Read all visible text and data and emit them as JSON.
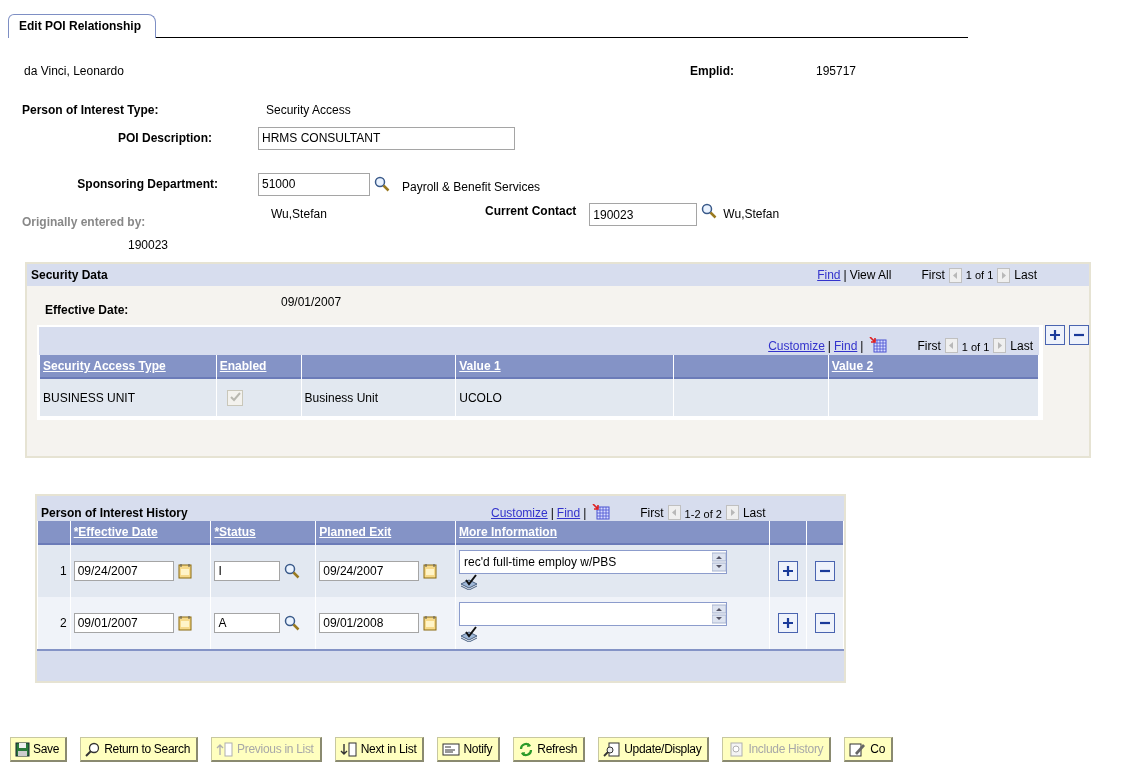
{
  "tab": {
    "label": "Edit POI Relationship",
    "selected": true
  },
  "person": {
    "name": "da Vinci, Leonardo",
    "emplid_label": "Emplid:",
    "emplid": "195717"
  },
  "poi_type": {
    "label": "Person of Interest Type:",
    "value": "Security Access"
  },
  "poi_description": {
    "label": "POI Description:",
    "value": "HRMS CONSULTANT"
  },
  "sponsoring_department": {
    "label": "Sponsoring Department:",
    "value": "51000",
    "description": "Payroll & Benefit Services"
  },
  "originally_entered_by": {
    "label": "Originally entered by:",
    "name": "Wu,Stefan",
    "number": "190023"
  },
  "current_contact": {
    "label": "Current Contact",
    "value": "190023",
    "name": "Wu,Stefan"
  },
  "security_data": {
    "title": "Security Data",
    "find": "Find",
    "separator": "|",
    "view_all": "View All",
    "nav": {
      "first": "First",
      "count": "1 of 1",
      "last": "Last",
      "prev_disabled": true,
      "next_disabled": true
    },
    "effective_date_label": "Effective Date:",
    "effective_date": "09/01/2007",
    "grid": {
      "customize": "Customize",
      "find": "Find",
      "separator": "|",
      "nav": {
        "first": "First",
        "count": "1 of 1",
        "last": "Last",
        "prev_disabled": true,
        "next_disabled": true
      },
      "columns": [
        "Security Access Type",
        "Enabled",
        "",
        "Value 1",
        "",
        "Value 2"
      ],
      "rows": [
        {
          "type": "BUSINESS UNIT",
          "enabled": true,
          "description": "Business Unit",
          "value_1": "UCOLO"
        }
      ]
    }
  },
  "history": {
    "title": "Person of Interest History",
    "customize": "Customize",
    "find": "Find",
    "separator": "|",
    "nav": {
      "first": "First",
      "count": "1-2 of 2",
      "last": "Last",
      "prev_disabled": true,
      "next_disabled": true
    },
    "columns": [
      "*Effective Date",
      "*Status",
      "Planned Exit",
      "More Information"
    ],
    "rows": [
      {
        "number": "1",
        "effective_date": "09/24/2007",
        "status": "I",
        "planned_exit": "09/24/2007",
        "more_information": "rec'd full-time employ w/PBS"
      },
      {
        "number": "2",
        "effective_date": "09/01/2007",
        "status": "A",
        "planned_exit": "09/01/2008"
      }
    ]
  },
  "buttons": [
    {
      "label": "Save",
      "kind": "save",
      "disabled": false
    },
    {
      "label": "Return to Search",
      "kind": "search",
      "disabled": false
    },
    {
      "label": "Previous in List",
      "kind": "previous",
      "disabled": true
    },
    {
      "label": "Next in List",
      "kind": "next",
      "disabled": false
    },
    {
      "label": "Notify",
      "kind": "notify",
      "disabled": false
    },
    {
      "label": "Refresh",
      "kind": "refresh",
      "disabled": false
    },
    {
      "label": "Update/Display",
      "kind": "update",
      "disabled": false
    },
    {
      "label": "Include History",
      "kind": "history",
      "disabled": true
    },
    {
      "label": "Co",
      "kind": "correct",
      "disabled": false
    }
  ]
}
